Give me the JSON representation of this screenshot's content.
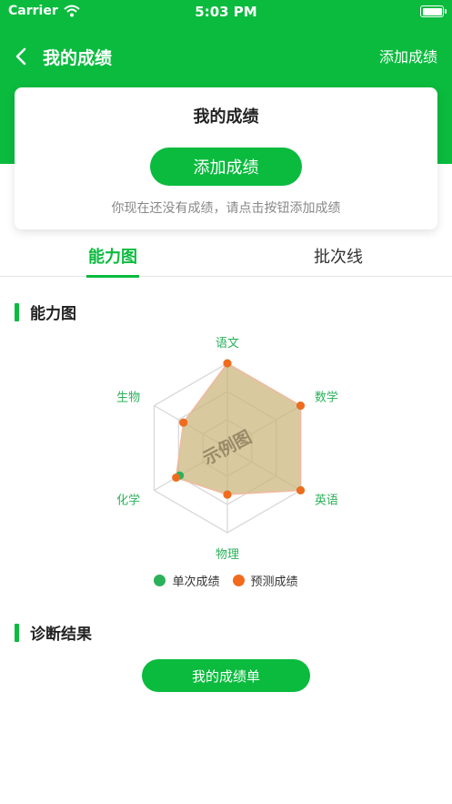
{
  "status_bar": {
    "carrier": "Carrier",
    "time": "5:03 PM"
  },
  "nav": {
    "title": "我的成绩",
    "action": "添加成绩"
  },
  "card": {
    "title": "我的成绩",
    "button": "添加成绩",
    "hint": "你现在还没有成绩，请点击按钮添加成绩"
  },
  "tabs": [
    {
      "label": "能力图",
      "active": true
    },
    {
      "label": "批次线",
      "active": false
    }
  ],
  "section_ability": {
    "title": "能力图"
  },
  "section_diagnosis": {
    "title": "诊断结果"
  },
  "report_button": "我的成绩单",
  "colors": {
    "brand": "#0abb3e",
    "series_single": "#2bb15a",
    "series_predicted": "#f26b1d",
    "fill": "#c9b47a",
    "label": "#2bb15a"
  },
  "chart_data": {
    "type": "radar",
    "axes": [
      "语文",
      "数学",
      "英语",
      "物理",
      "化学",
      "生物"
    ],
    "scale": [
      0,
      100
    ],
    "watermark": "示例图",
    "legend_position": "bottom",
    "series": [
      {
        "name": "单次成绩",
        "values": [
          100,
          100,
          100,
          55,
          65,
          60
        ]
      },
      {
        "name": "预测成绩",
        "values": [
          100,
          100,
          100,
          55,
          70,
          60
        ]
      }
    ]
  }
}
